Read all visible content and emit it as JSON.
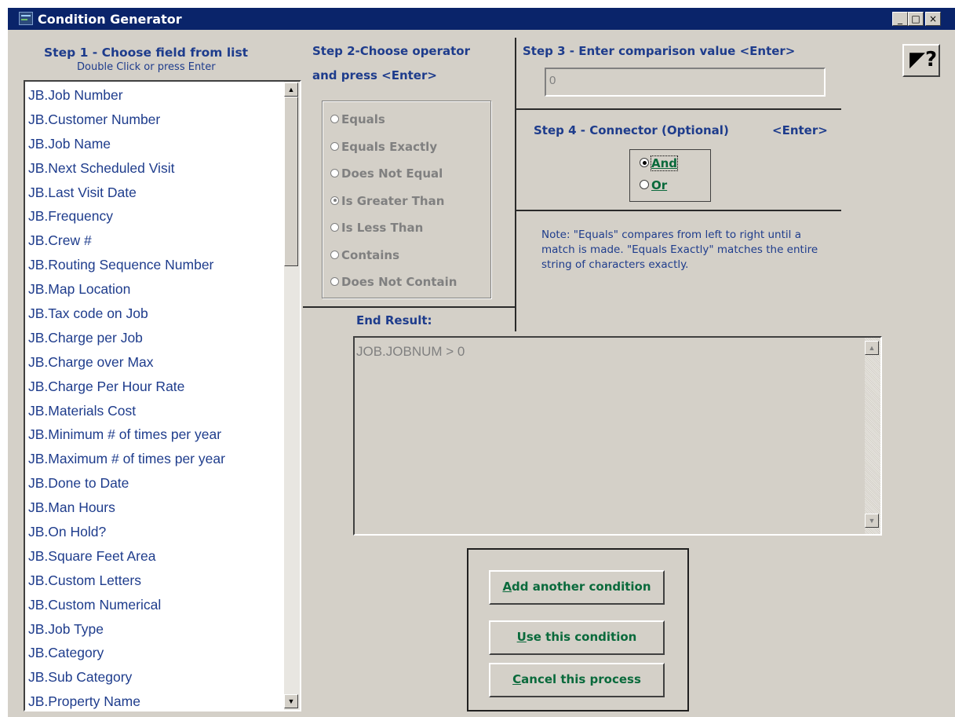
{
  "window": {
    "title": "Condition Generator",
    "minimize": "_",
    "maximize": "□",
    "close": "×"
  },
  "step1": {
    "title": "Step 1 - Choose field from list",
    "subtitle": "Double Click or press Enter",
    "fields": [
      "JB.Job Number",
      "JB.Customer Number",
      "JB.Job Name",
      "JB.Next Scheduled Visit",
      "JB.Last Visit Date",
      "JB.Frequency",
      "JB.Crew #",
      "JB.Routing Sequence Number",
      "JB.Map Location",
      "JB.Tax code on Job",
      "JB.Charge per Job",
      "JB.Charge over Max",
      "JB.Charge Per Hour Rate",
      "JB.Materials Cost",
      "JB.Minimum # of times per year",
      "JB.Maximum # of times per year",
      "JB.Done to Date",
      "JB.Man Hours",
      "JB.On Hold?",
      "JB.Square Feet Area",
      "JB.Custom Letters",
      "JB.Custom Numerical",
      "JB.Job Type",
      "JB.Category",
      "JB.Sub Category",
      "JB.Property Name"
    ]
  },
  "step2": {
    "title_line1": "Step 2-Choose operator",
    "title_line2": "and press <Enter>",
    "operators": [
      "Equals",
      "Equals Exactly",
      "Does Not Equal",
      "Is Greater Than",
      "Is Less Than",
      "Contains",
      "Does Not Contain"
    ],
    "selected": "Is Greater Than"
  },
  "step3": {
    "title": "Step 3 - Enter comparison value <Enter>",
    "value": "0"
  },
  "step4": {
    "title": "Step 4 - Connector  (Optional)",
    "enter_label": "<Enter>",
    "options": [
      "And",
      "Or"
    ],
    "selected": "And"
  },
  "note": "Note: \"Equals\" compares from left to right until a match is made. \"Equals Exactly\" matches the entire string of characters exactly.",
  "result": {
    "label": "End Result:",
    "text": "JOB.JOBNUM > 0"
  },
  "buttons": {
    "add": "Add another condition",
    "use": "Use this condition",
    "cancel": "Cancel this process"
  },
  "help_button": "?",
  "colors": {
    "titlebar": "#0a246a",
    "heading": "#1e3c8c",
    "button_text": "#0a6a3c",
    "panel": "#d4d0c8"
  }
}
